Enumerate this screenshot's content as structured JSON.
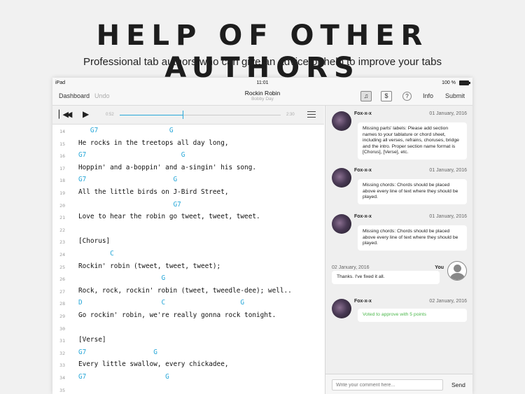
{
  "headline": "HELP OF OTHER AUTHORS",
  "subheadline": "Professional tab authors who can give an advice or help to improve your tabs",
  "status_bar": {
    "device": "iPad",
    "time": "11:01",
    "battery": "100 %"
  },
  "nav": {
    "dashboard": "Dashboard",
    "undo": "Undo",
    "song_title": "Rockin Robin",
    "artist": "Bobby Day",
    "info": "Info",
    "submit": "Submit",
    "icons": [
      "music-note-icon",
      "comment-icon",
      "help-icon"
    ]
  },
  "player": {
    "current_time": "0:52",
    "total_time": "2:30",
    "progress": 0.39
  },
  "tab_lines": [
    {
      "n": "14",
      "text": "   G7                  G",
      "chord": true
    },
    {
      "n": "15",
      "text": "He rocks in the treetops all day long,",
      "chord": false
    },
    {
      "n": "16",
      "text": "G7                        G",
      "chord": true
    },
    {
      "n": "17",
      "text": "Hoppin' and a-boppin' and a-singin' his song.",
      "chord": false
    },
    {
      "n": "18",
      "text": "G7                      G",
      "chord": true
    },
    {
      "n": "19",
      "text": "All the little birds on J-Bird Street,",
      "chord": false
    },
    {
      "n": "20",
      "text": "                        G7",
      "chord": true
    },
    {
      "n": "21",
      "text": "Love to hear the robin go tweet, tweet, tweet.",
      "chord": false
    },
    {
      "n": "22",
      "text": "",
      "chord": false
    },
    {
      "n": "23",
      "text": "[Chorus]",
      "chord": false
    },
    {
      "n": "24",
      "text": "        C",
      "chord": true
    },
    {
      "n": "25",
      "text": "Rockin' robin (tweet, tweet, tweet);",
      "chord": false
    },
    {
      "n": "26",
      "text": "                     G",
      "chord": true
    },
    {
      "n": "27",
      "text": "Rock, rock, rockin' robin (tweet, tweedle-dee); well..",
      "chord": false
    },
    {
      "n": "28",
      "text": "D                    C                   G",
      "chord": true
    },
    {
      "n": "29",
      "text": "Go rockin' robin, we're really gonna rock tonight.",
      "chord": false
    },
    {
      "n": "30",
      "text": "",
      "chord": false
    },
    {
      "n": "31",
      "text": "[Verse]",
      "chord": false
    },
    {
      "n": "32",
      "text": "G7                 G",
      "chord": true
    },
    {
      "n": "33",
      "text": "Every little swallow, every chickadee,",
      "chord": false
    },
    {
      "n": "34",
      "text": "G7                    G",
      "chord": true
    },
    {
      "n": "35",
      "text": "",
      "chord": false
    }
  ],
  "comments": [
    {
      "author": "Fox-x-x",
      "date": "01 January, 2016",
      "text": "Missing parts' labels: Please add section names to your tablature or chord sheet, including all verses, refrains, choruses, bridge and the intro. Proper section name format is [Chorus], [Verse], etc."
    },
    {
      "author": "Fox-x-x",
      "date": "01 January, 2016",
      "text": "Missing chords: Chords should be placed above every line of text where they should be played."
    },
    {
      "author": "Fox-x-x",
      "date": "01 January, 2016",
      "text": "Missing chords: Chords should be placed above every line of text where they should be played."
    },
    {
      "author": "You",
      "date": "02 January, 2016",
      "text": "Thanks. I've fixed it all."
    },
    {
      "author": "Fox-x-x",
      "date": "02 January, 2016",
      "text": "Voted to approve with 5 points"
    }
  ],
  "composer": {
    "placeholder": "Write your comment here...",
    "send": "Send"
  },
  "colors": {
    "chord": "#27a7d8",
    "vote": "#4cb84c"
  }
}
